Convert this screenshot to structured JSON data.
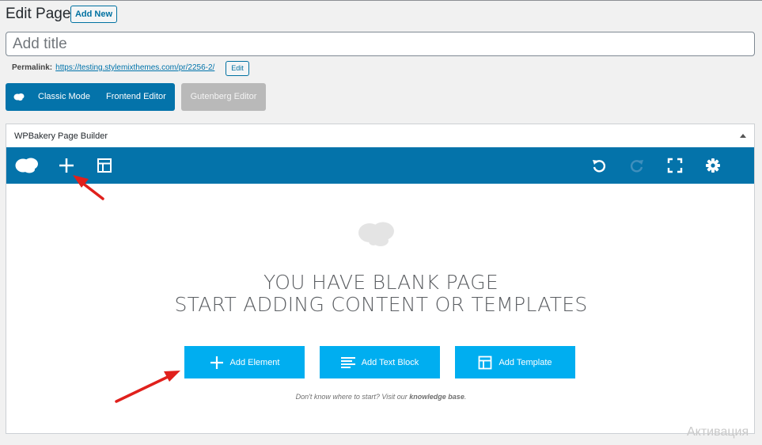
{
  "header": {
    "page_title": "Edit Page",
    "add_new_label": "Add New"
  },
  "title_field": {
    "placeholder": "Add title",
    "value": ""
  },
  "permalink": {
    "label": "Permalink:",
    "url": "https://testing.stylemixthemes.com/pr/2256-2/",
    "edit_label": "Edit"
  },
  "editor_modes": {
    "classic_label": "Classic Mode",
    "frontend_label": "Frontend Editor",
    "gutenberg_label": "Gutenberg Editor"
  },
  "builder": {
    "title": "WPBakery Page Builder",
    "toolbar_icons": [
      "wpbakery-logo-icon",
      "plus-icon",
      "layout-icon",
      "undo-icon",
      "redo-icon",
      "fullscreen-icon",
      "gear-icon"
    ],
    "blank_line1": "YOU HAVE BLANK PAGE",
    "blank_line2": "START ADDING CONTENT OR TEMPLATES",
    "add_element_label": "Add Element",
    "add_text_block_label": "Add Text Block",
    "add_template_label": "Add Template",
    "hint_prefix": "Don't know where to start? Visit our",
    "hint_link": "knowledge base",
    "hint_suffix": "."
  },
  "watermark": "Активация",
  "colors": {
    "toolbar_blue": "#0473aa",
    "cta_blue": "#00aef0",
    "annotation_red": "#e0201c",
    "link_blue": "#0073aa"
  }
}
